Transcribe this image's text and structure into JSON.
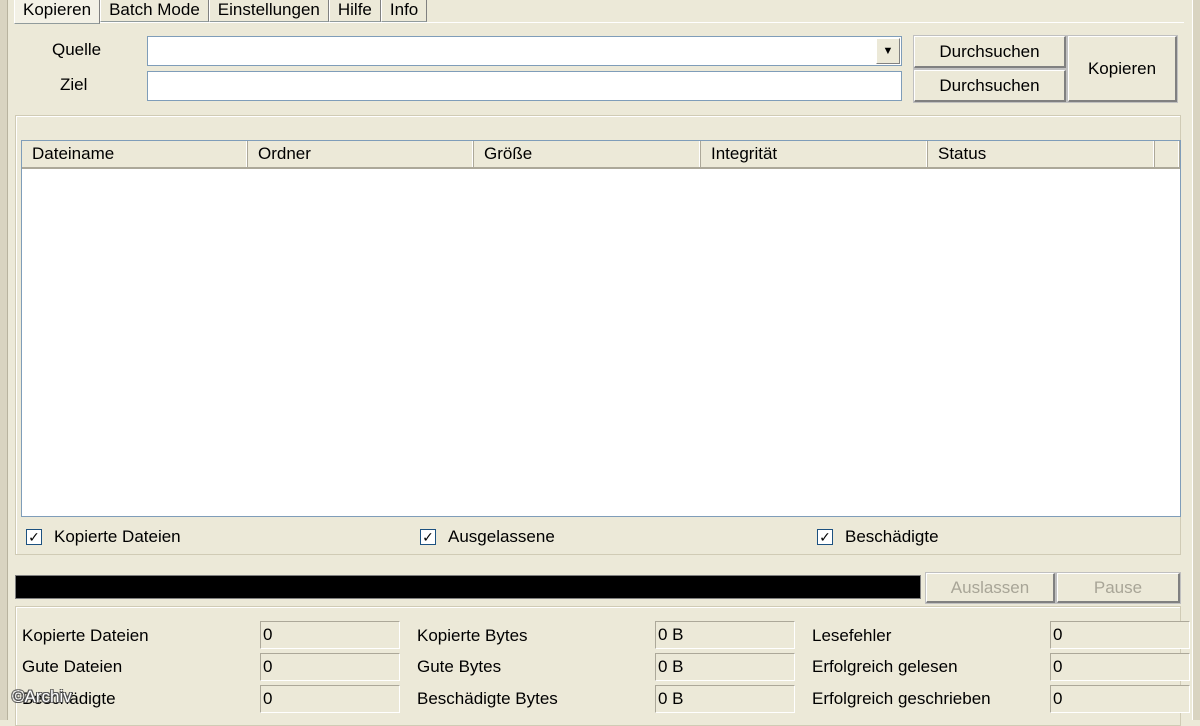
{
  "tabs": [
    {
      "label": "Kopieren",
      "active": true
    },
    {
      "label": "Batch Mode",
      "active": false
    },
    {
      "label": "Einstellungen",
      "active": false
    },
    {
      "label": "Hilfe",
      "active": false
    },
    {
      "label": "Info",
      "active": false
    }
  ],
  "source": {
    "label": "Quelle",
    "value": ""
  },
  "target": {
    "label": "Ziel",
    "value": ""
  },
  "buttons": {
    "browse_source": "Durchsuchen",
    "browse_target": "Durchsuchen",
    "copy": "Kopieren",
    "skip": "Auslassen",
    "pause": "Pause"
  },
  "file_list": {
    "columns": [
      "Dateiname",
      "Ordner",
      "Größe",
      "Integrität",
      "Status"
    ],
    "rows": []
  },
  "filters": [
    {
      "label": "Kopierte Dateien",
      "checked": true
    },
    {
      "label": "Ausgelassene",
      "checked": true
    },
    {
      "label": "Beschädigte",
      "checked": true
    }
  ],
  "progress": {
    "fill_color": "#000000"
  },
  "stats": {
    "col1": [
      {
        "label": "Kopierte Dateien",
        "value": "0"
      },
      {
        "label": "Gute Dateien",
        "value": "0"
      },
      {
        "label": "Beschädigte",
        "value": "0"
      }
    ],
    "col2": [
      {
        "label": "Kopierte Bytes",
        "value": "0 B"
      },
      {
        "label": "Gute Bytes",
        "value": "0 B"
      },
      {
        "label": "Beschädigte Bytes",
        "value": "0 B"
      }
    ],
    "col3": [
      {
        "label": "Lesefehler",
        "value": "0"
      },
      {
        "label": "Erfolgreich gelesen",
        "value": "0"
      },
      {
        "label": "Erfolgreich geschrieben",
        "value": "0"
      }
    ]
  },
  "watermark": "©Archiv"
}
